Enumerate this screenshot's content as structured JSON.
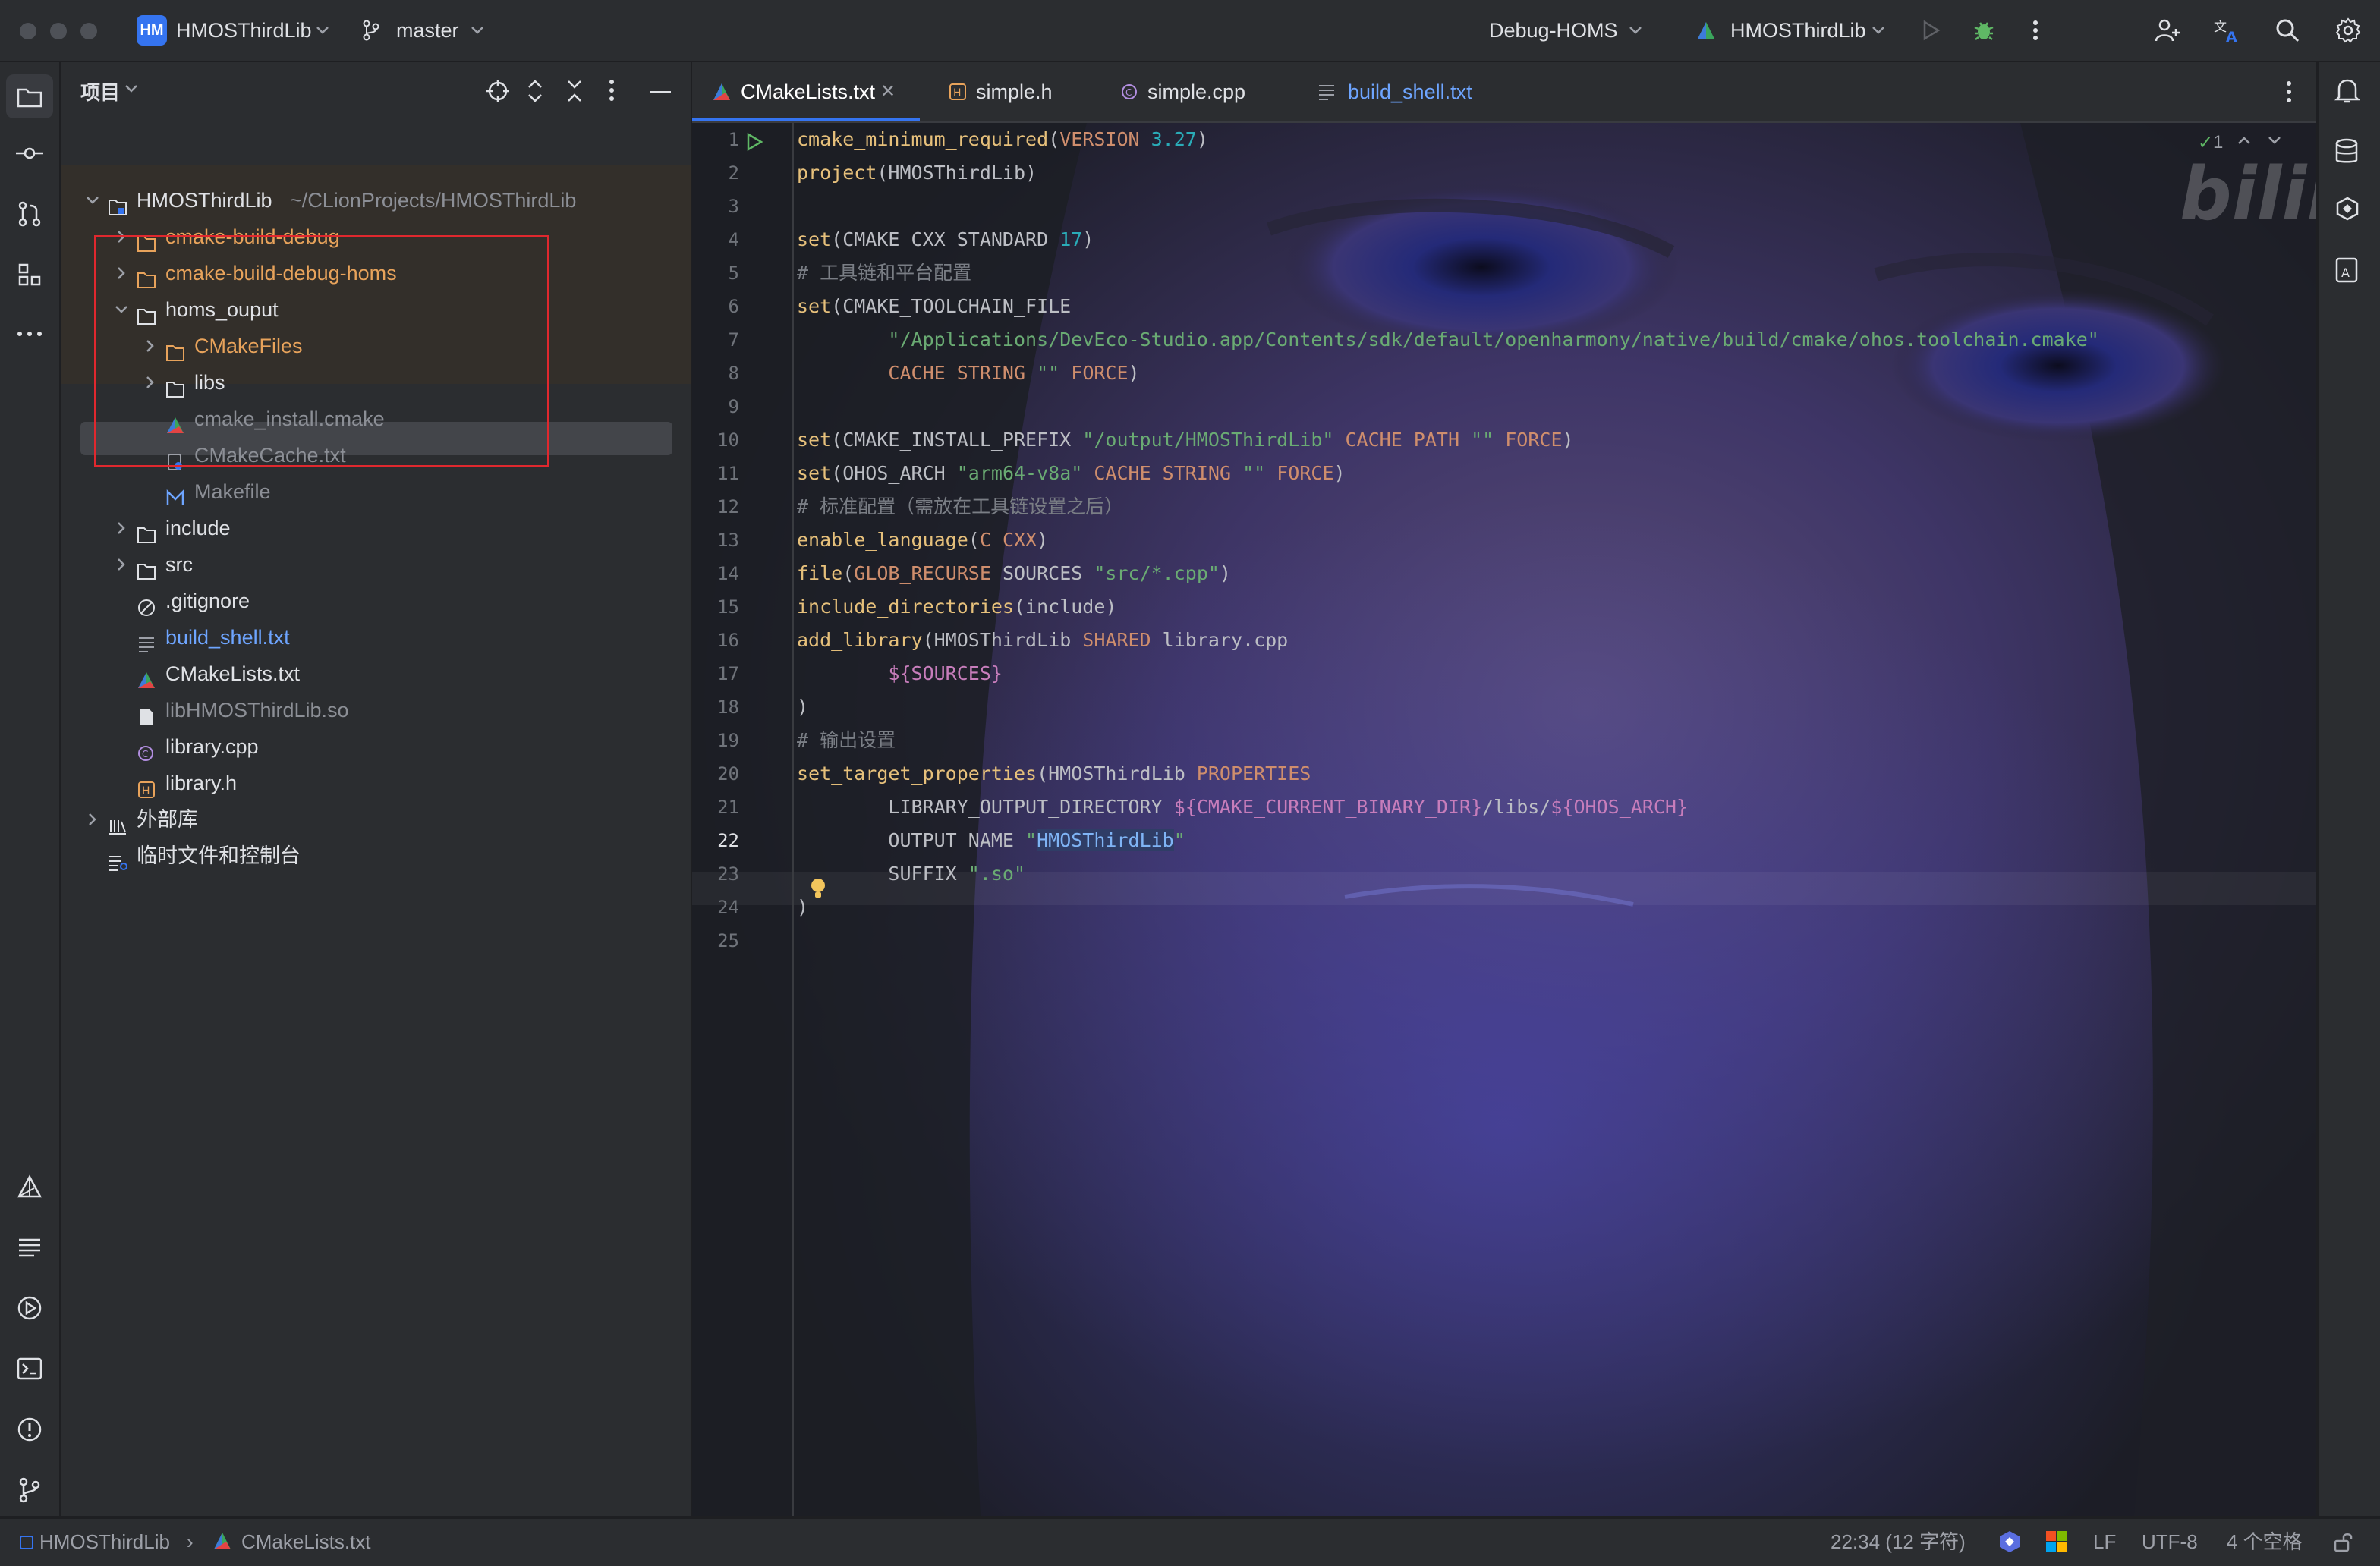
{
  "titlebar": {
    "project_badge": "HM",
    "project_name": "HMOSThirdLib",
    "branch": "master",
    "run_config": "Debug-HOMS",
    "target": "HMOSThirdLib"
  },
  "project_panel": {
    "title": "项目",
    "tree": [
      {
        "label": "HMOSThirdLib",
        "path": "~/CLionProjects/HMOSThirdLib",
        "color": "#dfe1e5"
      },
      {
        "label": "cmake-build-debug",
        "color": "#e8a35b"
      },
      {
        "label": "cmake-build-debug-homs",
        "color": "#e8a35b"
      },
      {
        "label": "homs_ouput",
        "color": "#dfe1e5"
      },
      {
        "label": "CMakeFiles",
        "color": "#e8a35b"
      },
      {
        "label": "libs",
        "color": "#dfe1e5"
      },
      {
        "label": "cmake_install.cmake",
        "color": "#8c8f96"
      },
      {
        "label": "CMakeCache.txt",
        "color": "#8c8f96"
      },
      {
        "label": "Makefile",
        "color": "#8c8f96"
      },
      {
        "label": "include",
        "color": "#dfe1e5"
      },
      {
        "label": "src",
        "color": "#dfe1e5"
      },
      {
        "label": ".gitignore",
        "color": "#dfe1e5"
      },
      {
        "label": "build_shell.txt",
        "color": "#6ea5ff"
      },
      {
        "label": "CMakeLists.txt",
        "color": "#dfe1e5"
      },
      {
        "label": "libHMOSThirdLib.so",
        "color": "#8c8f96"
      },
      {
        "label": "library.cpp",
        "color": "#dfe1e5"
      },
      {
        "label": "library.h",
        "color": "#dfe1e5"
      },
      {
        "label": "外部库",
        "color": "#dfe1e5"
      },
      {
        "label": "临时文件和控制台",
        "color": "#dfe1e5"
      }
    ]
  },
  "tabs": [
    {
      "label": "CMakeLists.txt",
      "active": true
    },
    {
      "label": "simple.h"
    },
    {
      "label": "simple.cpp"
    },
    {
      "label": "build_shell.txt"
    }
  ],
  "editor": {
    "inspection_count": "1",
    "watermark": "bilibili",
    "line_numbers": [
      "1",
      "2",
      "3",
      "4",
      "5",
      "6",
      "7",
      "8",
      "9",
      "10",
      "11",
      "12",
      "13",
      "14",
      "15",
      "16",
      "17",
      "18",
      "19",
      "20",
      "21",
      "22",
      "23",
      "24",
      "25"
    ],
    "lines": [
      [
        [
          "fn",
          "cmake_minimum_required"
        ],
        [
          "p",
          "("
        ],
        [
          "kw",
          "VERSION"
        ],
        [
          "p",
          " "
        ],
        [
          "num",
          "3.27"
        ],
        [
          "p",
          ")"
        ]
      ],
      [
        [
          "fn",
          "project"
        ],
        [
          "p",
          "(HMOSThirdLib)"
        ]
      ],
      [],
      [
        [
          "fn",
          "set"
        ],
        [
          "p",
          "(CMAKE_CXX_STANDARD "
        ],
        [
          "num",
          "17"
        ],
        [
          "p",
          ")"
        ]
      ],
      [
        [
          "cm",
          "# 工具链和平台配置"
        ]
      ],
      [
        [
          "fn",
          "set"
        ],
        [
          "p",
          "(CMAKE_TOOLCHAIN_FILE"
        ]
      ],
      [
        [
          "p",
          "        "
        ],
        [
          "str",
          "\"/Applications/DevEco-Studio.app/Contents/sdk/default/openharmony/native/build/cmake/ohos.toolchain.cmake\""
        ]
      ],
      [
        [
          "p",
          "        "
        ],
        [
          "kw",
          "CACHE STRING"
        ],
        [
          "p",
          " "
        ],
        [
          "str",
          "\"\""
        ],
        [
          "p",
          " "
        ],
        [
          "kw",
          "FORCE"
        ],
        [
          "p",
          ")"
        ]
      ],
      [],
      [
        [
          "fn",
          "set"
        ],
        [
          "p",
          "(CMAKE_INSTALL_PREFIX "
        ],
        [
          "str",
          "\"/output/HMOSThirdLib\""
        ],
        [
          "p",
          " "
        ],
        [
          "kw",
          "CACHE PATH"
        ],
        [
          "p",
          " "
        ],
        [
          "str",
          "\"\""
        ],
        [
          "p",
          " "
        ],
        [
          "kw",
          "FORCE"
        ],
        [
          "p",
          ")"
        ]
      ],
      [
        [
          "fn",
          "set"
        ],
        [
          "p",
          "(OHOS_ARCH "
        ],
        [
          "str",
          "\"arm64-v8a\""
        ],
        [
          "p",
          " "
        ],
        [
          "kw",
          "CACHE STRING"
        ],
        [
          "p",
          " "
        ],
        [
          "str",
          "\"\""
        ],
        [
          "p",
          " "
        ],
        [
          "kw",
          "FORCE"
        ],
        [
          "p",
          ")"
        ]
      ],
      [
        [
          "cm",
          "# 标准配置（需放在工具链设置之后）"
        ]
      ],
      [
        [
          "fn",
          "enable_language"
        ],
        [
          "p",
          "("
        ],
        [
          "kw",
          "C CXX"
        ],
        [
          "p",
          ")"
        ]
      ],
      [
        [
          "fn",
          "file"
        ],
        [
          "p",
          "("
        ],
        [
          "kw",
          "GLOB_RECURSE"
        ],
        [
          "p",
          " SOURCES "
        ],
        [
          "str",
          "\"src/*.cpp\""
        ],
        [
          "p",
          ")"
        ]
      ],
      [
        [
          "fn",
          "include_directories"
        ],
        [
          "p",
          "(include)"
        ]
      ],
      [
        [
          "fn",
          "add_library"
        ],
        [
          "p",
          "(HMOSThirdLib "
        ],
        [
          "kw",
          "SHARED"
        ],
        [
          "p",
          " library.cpp"
        ]
      ],
      [
        [
          "p",
          "        "
        ],
        [
          "var",
          "${SOURCES}"
        ]
      ],
      [
        [
          "p",
          ")"
        ]
      ],
      [
        [
          "cm",
          "# 输出设置"
        ]
      ],
      [
        [
          "fn",
          "set_target_properties"
        ],
        [
          "p",
          "(HMOSThirdLib "
        ],
        [
          "kw",
          "PROPERTIES"
        ]
      ],
      [
        [
          "p",
          "        LIBRARY_OUTPUT_DIRECTORY "
        ],
        [
          "var",
          "${CMAKE_CURRENT_BINARY_DIR}"
        ],
        [
          "p",
          "/libs/"
        ],
        [
          "var",
          "${OHOS_ARCH}"
        ]
      ],
      [
        [
          "p",
          "        OUTPUT_NAME "
        ],
        [
          "str",
          "\""
        ],
        [
          "hl",
          "HMOSThirdLib"
        ],
        [
          "str",
          "\""
        ]
      ],
      [
        [
          "p",
          "        SUFFIX "
        ],
        [
          "str",
          "\".so\""
        ]
      ],
      [
        [
          "p",
          ")"
        ]
      ],
      []
    ]
  },
  "statusbar": {
    "crumb_project": "HMOSThirdLib",
    "crumb_file": "CMakeLists.txt",
    "caret": "22:34 (12 字符)",
    "line_sep": "LF",
    "encoding": "UTF-8",
    "indent": "4 个空格"
  },
  "colors": {
    "accent": "#3574f0",
    "selection_box": "#e0282e",
    "folder_excluded": "#e8a35b",
    "run_green": "#5fb865"
  }
}
